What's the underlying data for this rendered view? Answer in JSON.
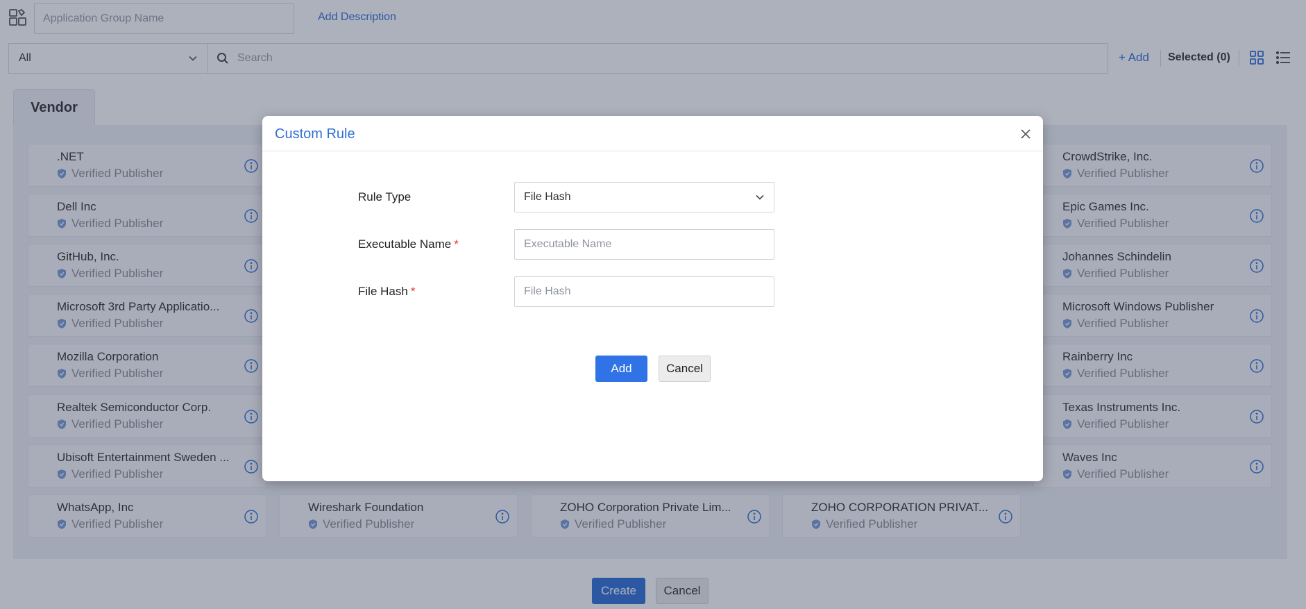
{
  "header": {
    "group_name_placeholder": "Application Group Name",
    "add_description": "Add Description"
  },
  "toolbar": {
    "filter_value": "All",
    "search_placeholder": "Search",
    "add_label": "+ Add",
    "selected_label": "Selected (0)"
  },
  "vendor": {
    "tab_label": "Vendor",
    "publisher_label": "Verified Publisher",
    "cards": [
      {
        "name": ".NET"
      },
      {
        "name": "Dell Inc"
      },
      {
        "name": "GitHub, Inc."
      },
      {
        "name": "Microsoft 3rd Party Applicatio..."
      },
      {
        "name": "Mozilla Corporation"
      },
      {
        "name": "Realtek Semiconductor Corp."
      },
      {
        "name": "Ubisoft Entertainment Sweden ..."
      },
      {
        "name": "WhatsApp, Inc"
      },
      {
        "name": "Wireshark Foundation"
      },
      {
        "name": "ZOHO Corporation Private Lim..."
      },
      {
        "name": "ZOHO CORPORATION PRIVAT..."
      },
      {
        "name": "CrowdStrike, Inc."
      },
      {
        "name": "Epic Games Inc."
      },
      {
        "name": "Johannes Schindelin"
      },
      {
        "name": "Microsoft Windows Publisher"
      },
      {
        "name": "Rainberry Inc"
      },
      {
        "name": "Texas Instruments Inc."
      },
      {
        "name": "Waves Inc"
      }
    ]
  },
  "footer": {
    "create_label": "Create",
    "cancel_label": "Cancel"
  },
  "modal": {
    "title": "Custom Rule",
    "rule_type_label": "Rule Type",
    "rule_type_value": "File Hash",
    "executable_name_label": "Executable Name",
    "executable_name_placeholder": "Executable Name",
    "file_hash_label": "File Hash",
    "file_hash_placeholder": "File Hash",
    "required_mark": "*",
    "add_label": "Add",
    "cancel_label": "Cancel"
  },
  "colors": {
    "accent": "#2f6fd6",
    "required": "#e53935",
    "overlay": "#283250"
  },
  "icons": [
    "app-group-icon",
    "chevron-down-icon",
    "search-icon",
    "grid-view-icon",
    "list-view-icon",
    "shield-icon",
    "info-icon",
    "close-icon"
  ]
}
